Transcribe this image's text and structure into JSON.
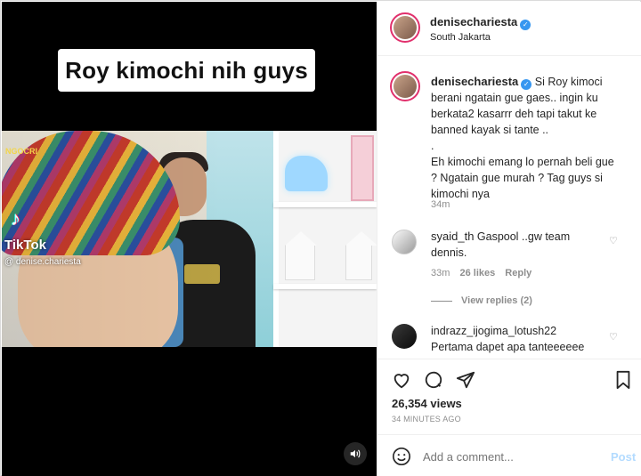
{
  "video": {
    "caption_overlay": "Roy kimochi nih guys",
    "tiktok_label": "TikTok",
    "tiktok_user": "@ denise.chariesta",
    "background_sign": "NGOCRI"
  },
  "post": {
    "author": "denisechariesta",
    "location": "South Jakarta",
    "caption_lines": [
      "Si Roy kimoci",
      "berani ngatain gue gaes.. ingin ku",
      "berkata2 kasarrr deh tapi takut ke",
      "banned kayak si tante ..",
      ".",
      "Eh kimochi emang lo pernah beli gue",
      "? Ngatain gue murah ? Tag guys si",
      "kimochi nya"
    ],
    "caption_time": "34m",
    "comments": [
      {
        "user": "syaid_th",
        "text_first": "Gaspool ..gw team",
        "text_second": "dennis.",
        "time": "33m",
        "likes": "26 likes",
        "reply": "Reply",
        "view_replies": "View replies (2)"
      },
      {
        "user": "indrazz_ijogima_lotush22",
        "text_first": "Pertama dapet apa tanteeeeee"
      }
    ],
    "views": "26,354 views",
    "timestamp": "34 MINUTES AGO",
    "add_comment_placeholder": "Add a comment...",
    "post_button": "Post"
  },
  "colors": {
    "verified": "#3897f0",
    "post_button": "#b3dbff",
    "meta_gray": "#8e8e8e"
  },
  "icons": [
    "verified-icon",
    "heart-icon",
    "comment-icon",
    "share-icon",
    "bookmark-icon",
    "emoji-icon",
    "volume-icon"
  ]
}
